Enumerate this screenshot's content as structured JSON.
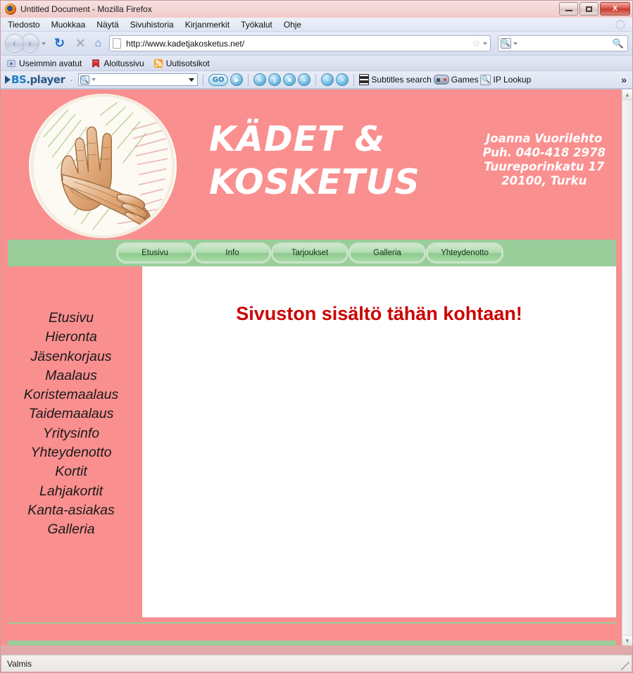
{
  "window": {
    "title": "Untitled Document - Mozilla Firefox",
    "app_icon": "firefox-icon",
    "minimize_label": "",
    "maximize_label": "",
    "close_label": "X"
  },
  "menubar": {
    "items": [
      {
        "label": "Tiedosto",
        "accel": "T"
      },
      {
        "label": "Muokkaa",
        "accel": "M"
      },
      {
        "label": "Näytä",
        "accel": "N"
      },
      {
        "label": "Sivuhistoria",
        "accel": "S"
      },
      {
        "label": "Kirjanmerkit",
        "accel": "K"
      },
      {
        "label": "Työkalut",
        "accel": "y"
      },
      {
        "label": "Ohje",
        "accel": "O"
      }
    ]
  },
  "toolbar": {
    "back_label": "‹",
    "forward_label": "›",
    "reload_label": "↻",
    "stop_label": "✕",
    "home_label": "⌂",
    "url": "http://www.kadetjakosketus.net/",
    "url_placeholder": "",
    "bookmark_star": "☆",
    "search_value": "",
    "search_placeholder": "",
    "search_icon": "magnifier-icon"
  },
  "bookmarks": {
    "items": [
      {
        "label": "Useimmin avatut",
        "icon": "folder-star-icon"
      },
      {
        "label": "Aloitussivu",
        "icon": "bookmark-red-icon"
      },
      {
        "label": "Uutisotsikot",
        "icon": "rss-icon"
      }
    ]
  },
  "bsplayer": {
    "logo_text": "BS",
    "logo_text2": ".player",
    "separator": "·",
    "search_value": "",
    "search_placeholder": "",
    "go_label": "GO",
    "buttons": [
      {
        "name": "play-button",
        "glyph": "▶"
      },
      {
        "name": "previous-button",
        "glyph": "«"
      },
      {
        "name": "pause-button",
        "glyph": "❙"
      },
      {
        "name": "stop-button",
        "glyph": "■"
      },
      {
        "name": "next-button",
        "glyph": "»"
      },
      {
        "name": "volume-down-button",
        "glyph": "−"
      },
      {
        "name": "volume-up-button",
        "glyph": "+"
      }
    ],
    "links": [
      {
        "label": "Subtitles search",
        "icon": "film-icon"
      },
      {
        "label": "Games",
        "icon": "gamepad-icon"
      },
      {
        "label": "IP Lookup",
        "icon": "magnifier-icon"
      }
    ],
    "overflow_label": "»"
  },
  "site": {
    "title_line1": "KÄDET &",
    "title_line2": "KOSKETUS",
    "logo_alt": "hands-sketch-logo",
    "contact": "Joanna Vuorilehto\nPuh. 040-418 2978\nTuureporinkatu 17\n20100, Turku",
    "nav_tabs": [
      {
        "label": "Etusivu"
      },
      {
        "label": "Info"
      },
      {
        "label": "Tarjoukset"
      },
      {
        "label": "Galleria"
      },
      {
        "label": "Yhteydenotto"
      }
    ],
    "sidebar_items": [
      {
        "label": "Etusivu"
      },
      {
        "label": "Hieronta"
      },
      {
        "label": "Jäsenkorjaus"
      },
      {
        "label": "Maalaus"
      },
      {
        "label": "Koristemaalaus"
      },
      {
        "label": "Taidemaalaus"
      },
      {
        "label": "Yritysinfo"
      },
      {
        "label": "Yhteydenotto"
      },
      {
        "label": "Kortit"
      },
      {
        "label": "Lahjakortit"
      },
      {
        "label": "Kanta-asiakas"
      },
      {
        "label": "Galleria"
      }
    ],
    "content_heading": "Sivuston sisältö tähän kohtaan!"
  },
  "statusbar": {
    "text": "Valmis"
  },
  "colors": {
    "page_pink": "#fa8f8f",
    "page_green": "#9bcd9b",
    "heading_red": "#cc0000",
    "title_white": "#ffffff",
    "close_button_red": "#c43a2d"
  }
}
